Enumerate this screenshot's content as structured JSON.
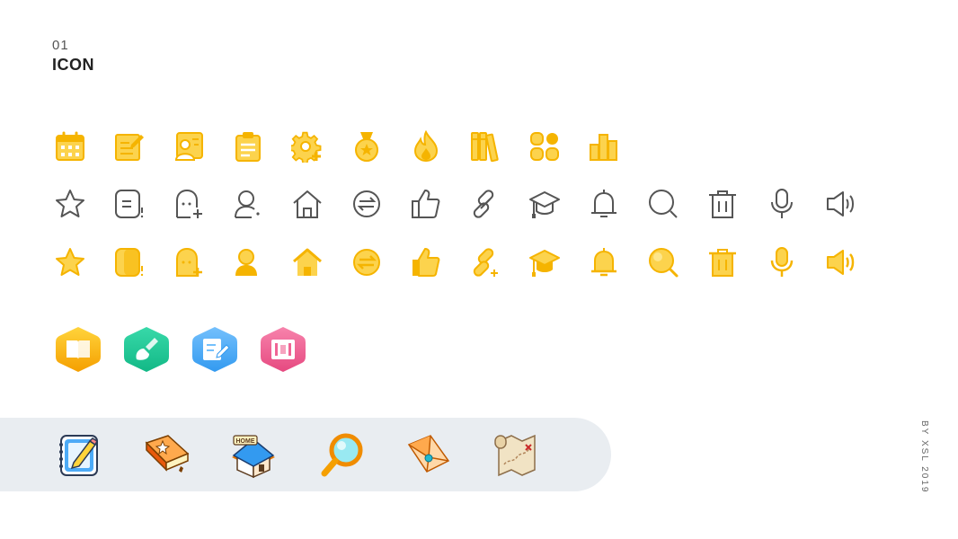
{
  "header": {
    "number": "01",
    "title": "ICON"
  },
  "credit": "BY XSL 2019",
  "colors": {
    "yellow": "#fcd34d",
    "yellow_dark": "#f5b400",
    "outline": "#555555",
    "band": "#e9edf1"
  },
  "rows": {
    "filled_set": [
      "calendar-icon",
      "edit-icon",
      "id-card-icon",
      "clipboard-icon",
      "gear-add-icon",
      "medal-icon",
      "fire-icon",
      "books-icon",
      "apps-grid-icon",
      "bar-chart-icon"
    ],
    "outline_set": [
      "star-icon",
      "chat-icon",
      "ghost-add-icon",
      "user-icon",
      "home-icon",
      "exchange-icon",
      "thumbs-up-icon",
      "link-icon",
      "graduation-cap-icon",
      "bell-icon",
      "search-icon",
      "trash-icon",
      "microphone-icon",
      "speaker-icon"
    ],
    "filled_duotone_set": [
      "star-icon",
      "chat-icon",
      "ghost-add-icon",
      "user-icon",
      "home-icon",
      "exchange-icon",
      "thumbs-up-icon",
      "link-icon",
      "graduation-cap-icon",
      "bell-icon",
      "search-icon",
      "trash-icon",
      "microphone-icon",
      "speaker-icon"
    ]
  },
  "hexagon_badges": [
    {
      "name": "book-badge-icon",
      "color": "#fcc419"
    },
    {
      "name": "brush-badge-icon",
      "color": "#20c997"
    },
    {
      "name": "note-badge-icon",
      "color": "#4dabf7"
    },
    {
      "name": "film-badge-icon",
      "color": "#f06595"
    }
  ],
  "illustrations": [
    "notebook-pen-icon",
    "magic-book-icon",
    "home-house-icon",
    "magnifier-icon",
    "envelope-icon",
    "treasure-map-icon"
  ],
  "illustration_text": {
    "home_sign": "HOME"
  }
}
